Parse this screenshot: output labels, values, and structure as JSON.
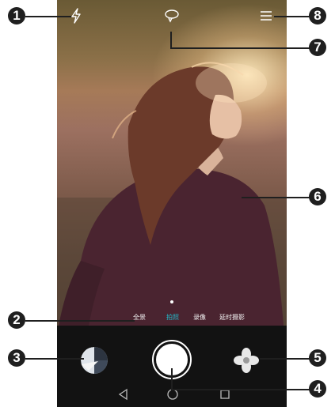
{
  "camera": {
    "modes": [
      {
        "label": "全景",
        "active": false
      },
      {
        "label": "拍照",
        "active": true
      },
      {
        "label": "录像",
        "active": false
      },
      {
        "label": "延时摄影",
        "active": false
      }
    ],
    "accent_color": "#23b6c6"
  },
  "callouts": [
    "1",
    "2",
    "3",
    "4",
    "5",
    "6",
    "7",
    "8"
  ],
  "icons": {
    "flash": "flash-icon",
    "switch_camera": "switch-camera-icon",
    "menu": "menu-icon",
    "gallery": "gallery-thumbnail",
    "filter": "filter-flower-icon",
    "back": "back-triangle-icon",
    "home": "home-circle-icon",
    "recent": "recent-square-icon"
  }
}
